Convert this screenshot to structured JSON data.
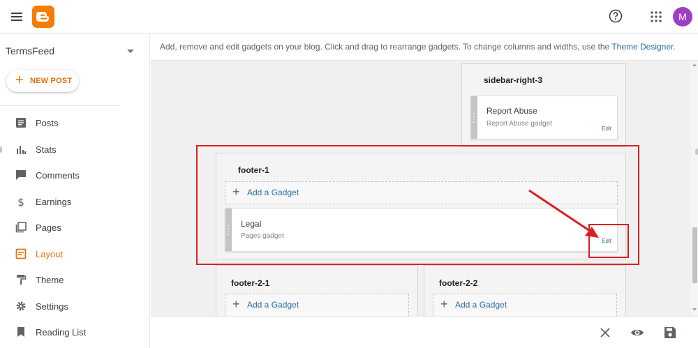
{
  "header": {
    "avatar_initial": "M"
  },
  "sidebar": {
    "blog_name": "TermsFeed",
    "new_post_label": "NEW POST",
    "items": [
      {
        "label": "Posts",
        "icon": "posts-icon"
      },
      {
        "label": "Stats",
        "icon": "stats-icon"
      },
      {
        "label": "Comments",
        "icon": "comments-icon"
      },
      {
        "label": "Earnings",
        "icon": "dollar-icon"
      },
      {
        "label": "Pages",
        "icon": "pages-icon"
      },
      {
        "label": "Layout",
        "icon": "layout-icon"
      },
      {
        "label": "Theme",
        "icon": "paint-roller-icon"
      },
      {
        "label": "Settings",
        "icon": "gear-icon"
      },
      {
        "label": "Reading List",
        "icon": "bookmark-icon"
      }
    ],
    "active_item": "Layout"
  },
  "main": {
    "info_text": "Add, remove and edit gadgets on your blog. Click and drag to rearrange gadgets. To change columns and widths, use the ",
    "info_link": "Theme Designer",
    "info_end": "."
  },
  "sections": {
    "sidebar_right_3": {
      "title": "sidebar-right-3",
      "gadget": {
        "title": "Report Abuse",
        "subtitle": "Report Abuse gadget",
        "edit": "Edit"
      }
    },
    "footer_1": {
      "title": "footer-1",
      "add_label": "Add a Gadget",
      "gadget": {
        "title": "Legal",
        "subtitle": "Pages gadget",
        "edit": "Edit"
      }
    },
    "footer_2_1": {
      "title": "footer-2-1",
      "add_label": "Add a Gadget"
    },
    "footer_2_2": {
      "title": "footer-2-2",
      "add_label": "Add a Gadget"
    }
  },
  "colors": {
    "brand": "#f57d00",
    "accent": "#e8710a",
    "link": "#2a6aa6",
    "highlight": "#d8211f",
    "avatar": "#9c3fc7"
  }
}
